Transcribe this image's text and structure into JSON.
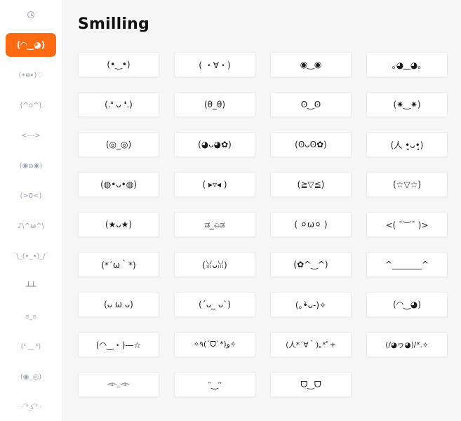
{
  "page": {
    "title": "Smilling"
  },
  "colors": {
    "accent": "#ff6a13",
    "sidebar_text": "#9aa3b4"
  },
  "sidebar": {
    "items": [
      {
        "icon": "recent-clock-icon",
        "label": ""
      },
      {
        "label": "(◠‿◕)",
        "active": true
      },
      {
        "label": "(•ө•)♡"
      },
      {
        "label": "(^o^)"
      },
      {
        "label": "<--->"
      },
      {
        "label": "(◉ɷ◉)"
      },
      {
        "label": "(>0<)"
      },
      {
        "label": "♪\\^ω^\\"
      },
      {
        "label": "¯\\_(•_•)_/¯"
      },
      {
        "label": "┴┴"
      },
      {
        "label": "ಠ_ಠ"
      },
      {
        "label": "(❛ ‿ ❛)"
      },
      {
        "label": "(◉_◎)"
      },
      {
        "label": "☞ ͡° ͜ʖ ͡°☞"
      }
    ]
  },
  "emoticons": [
    "(•‿•)",
    "( ・∀・)",
    "◉‿◉",
    "｡◕‿◕｡",
    "(.❛ ᴗ ❛.)",
    "(θ_θ)",
    "ʘ‿ʘ",
    "(✷‿✷)",
    "(◎_◎)",
    "(◕ᴗ◕✿)",
    "(ʘᴗʘ✿)",
    "(人 •͈ᴗ•͈)",
    "(◍•ᴗ•◍)",
    "( ▸▿◂ )",
    "(≧▽≦)",
    "(☆▽☆)",
    "(★ᴗ★)",
    "ಡ_ಎಡ",
    "( ⚪ω⚪ )",
    "<( ¯︶¯ )>",
    "(*´ω｀*)",
    "(ꈍᴗꈍ)",
    "(✿^‿^)",
    "^_______^",
    "(ᴗ ω ᴗ)",
    "(´ᴗ_ ᴗ`)",
    "(｡•̀ᴗ-)✧",
    "(◠‿◕)",
    "(◠‿・)—☆",
    "✧٩(ˊᗜˋ*)و✧",
    "(人*´∀｀)｡*ﾟ+",
    "(/◕ヮ◕)/*.✧",
    "◅▻_◅▻",
    "ᵔ‿ᵔ",
    "ᗜ‿ᗜ"
  ]
}
